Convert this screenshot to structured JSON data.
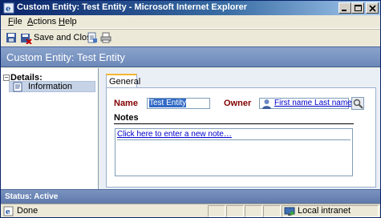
{
  "window": {
    "title": "Custom Entity: Test Entity - Microsoft Internet Explorer"
  },
  "menu": {
    "items": [
      {
        "accel": "F",
        "rest": "ile"
      },
      {
        "accel": "A",
        "rest": "ctions"
      },
      {
        "accel": "H",
        "rest": "elp"
      }
    ]
  },
  "toolbar": {
    "save_close_label": "Save and Close"
  },
  "header": {
    "title": "Custom Entity: Test Entity"
  },
  "nav": {
    "section_label": "Details:",
    "expander": "−",
    "items": [
      {
        "label": "Information"
      }
    ]
  },
  "form": {
    "tab_label": "General",
    "name_label": "Name",
    "name_value": "Test Entity",
    "owner_label": "Owner",
    "owner_value": "First name Last name",
    "notes_label": "Notes",
    "notes_prompt": "Click here to enter a new note…"
  },
  "status": {
    "label": "Status: Active"
  },
  "ie_status": {
    "left_text": "Done",
    "zone_text": "Local intranet"
  },
  "colors": {
    "header_band": "#7a93c0",
    "field_label": "#800000",
    "link": "#0000cc",
    "tab_accent": "#f7b52d"
  }
}
